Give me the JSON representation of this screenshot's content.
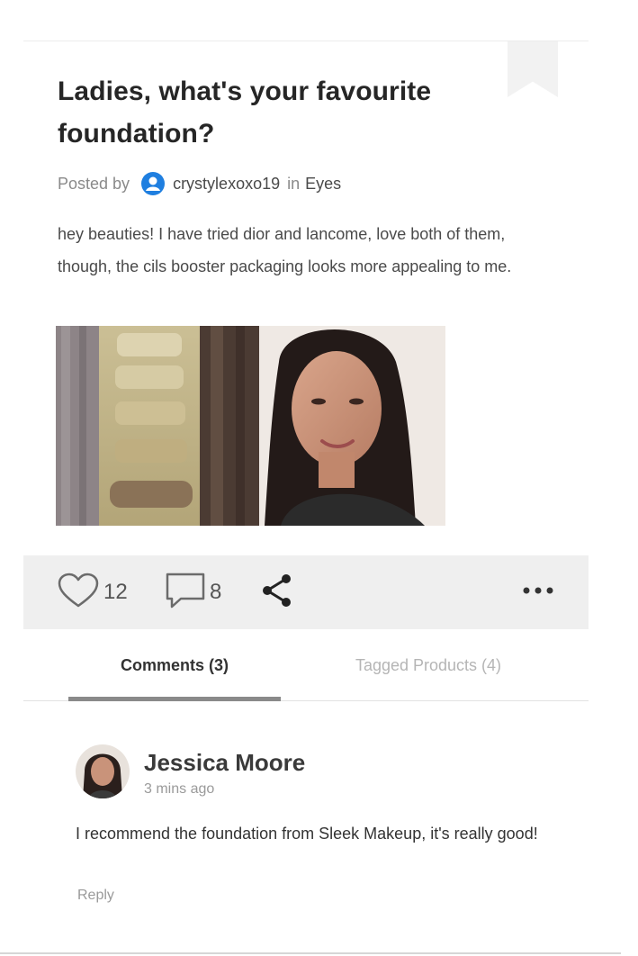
{
  "post": {
    "title": "Ladies, what's your favourite foundation?",
    "posted_by_label": "Posted by",
    "username": "crystylexoxo19",
    "in_label": "in",
    "category": "Eyes",
    "body": "hey beauties! I have tried dior and lancome, love both of them, though, the cils booster packaging looks more appealing to me."
  },
  "actions": {
    "like_count": "12",
    "comment_count": "8"
  },
  "tabs": [
    {
      "label": "Comments (3)",
      "active": true
    },
    {
      "label": "Tagged Products (4)",
      "active": false
    }
  ],
  "comment": {
    "author": "Jessica Moore",
    "time": "3 mins ago",
    "text": "I recommend the foundation from Sleek Makeup, it's really good!",
    "reply_label": "Reply"
  },
  "icons": {
    "bookmark": "bookmark-icon",
    "user_badge": "user-icon",
    "like": "heart-icon",
    "comment": "speech-bubble-icon",
    "share": "share-icon",
    "more": "more-dots-icon"
  },
  "colors": {
    "user_badge": "#1f7fe0",
    "action_bar_bg": "#efefef",
    "active_tab_indicator": "#8a8a8a"
  }
}
